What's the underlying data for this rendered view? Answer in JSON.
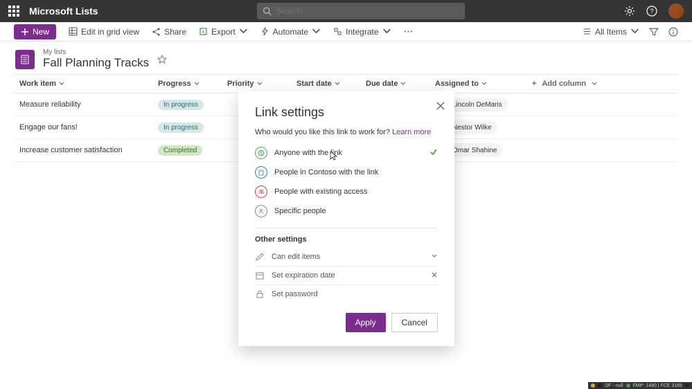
{
  "app": {
    "title": "Microsoft Lists"
  },
  "search": {
    "placeholder": "Search"
  },
  "cmdbar": {
    "new": "New",
    "edit_grid": "Edit in grid view",
    "share": "Share",
    "export": "Export",
    "automate": "Automate",
    "integrate": "Integrate",
    "all_items": "All Items"
  },
  "header": {
    "breadcrumb": "My lists",
    "title": "Fall Planning Tracks"
  },
  "columns": {
    "work_item": "Work item",
    "progress": "Progress",
    "priority": "Priority",
    "start_date": "Start date",
    "due_date": "Due date",
    "assigned_to": "Assigned to",
    "add_column": "Add column"
  },
  "rows": [
    {
      "work": "Measure reliability",
      "progress": "In progress",
      "assignee": "Lincoln DeMaris"
    },
    {
      "work": "Engage our fans!",
      "progress": "In progress",
      "assignee": "Nestor Wilke"
    },
    {
      "work": "Increase customer satisfaction",
      "progress": "Completed",
      "assignee": "Omar Shahine"
    }
  ],
  "modal": {
    "title": "Link settings",
    "question": "Who would you like this link to work for? ",
    "learn_more": "Learn more",
    "options": {
      "anyone": "Anyone with the link",
      "org": "People in Contoso with the link",
      "existing": "People with existing access",
      "specific": "Specific people"
    },
    "other_settings": "Other settings",
    "can_edit": "Can edit items",
    "expire": "Set expiration date",
    "password": "Set password",
    "apply": "Apply",
    "cancel": "Cancel"
  },
  "status": {
    "df": "DF - null",
    "fmp": "FMP: 1480 | FCE 3165"
  }
}
